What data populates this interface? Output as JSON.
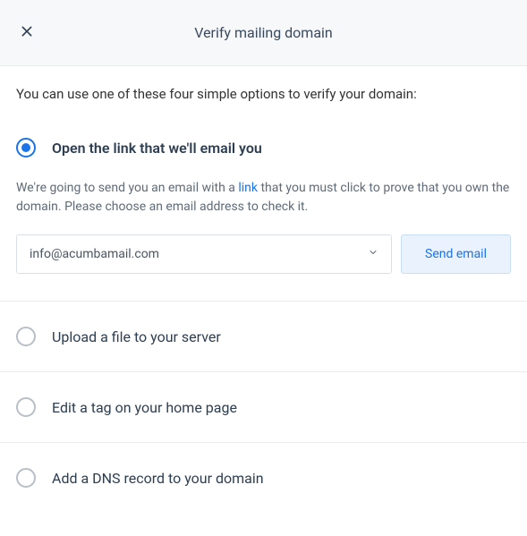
{
  "header": {
    "title": "Verify mailing domain"
  },
  "intro": "You can use one of these four simple options to verify your domain:",
  "options": {
    "opt1": {
      "label": "Open the link that we'll email you",
      "desc_before": "We're going to send you an email with a ",
      "desc_link": "link",
      "desc_after": " that you must click to prove that you own the domain. Please choose an email address to check it.",
      "email": "info@acumbamail.com",
      "send_button": "Send email"
    },
    "opt2": {
      "label": "Upload a file to your server"
    },
    "opt3": {
      "label": "Edit a tag on your home page"
    },
    "opt4": {
      "label": "Add a DNS record to your domain"
    }
  }
}
